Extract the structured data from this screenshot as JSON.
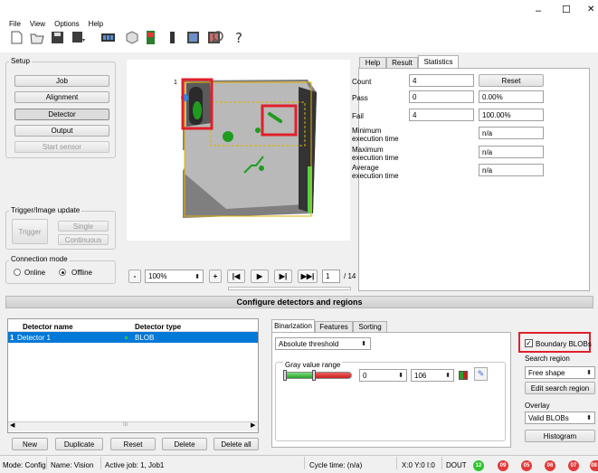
{
  "menu": [
    "File",
    "View",
    "Options",
    "Help"
  ],
  "window": {
    "minimize": "–",
    "maximize": "☐",
    "close": "✕"
  },
  "setup": {
    "title": "Setup",
    "buttons": [
      "Job",
      "Alignment",
      "Detector",
      "Output",
      "Start sensor"
    ]
  },
  "trigger": {
    "title": "Trigger/Image update",
    "trigger": "Trigger",
    "single": "Single",
    "continuous": "Continuous"
  },
  "connection": {
    "title": "Connection mode",
    "online": "Online",
    "offline": "Offline"
  },
  "imagectrl": {
    "minus": "-",
    "zoom": "100%",
    "plus": "+",
    "page": "1",
    "total": "/ 14"
  },
  "image": {
    "marker_label": "1"
  },
  "tabs": {
    "help": "Help",
    "result": "Result",
    "statistics": "Statistics"
  },
  "stats": {
    "count_label": "Count",
    "count_value": "4",
    "reset": "Reset",
    "pass_label": "Pass",
    "pass_value": "0",
    "pass_pct": "0.00%",
    "fail_label": "Fail",
    "fail_value": "4",
    "fail_pct": "100.00%",
    "min_label_1": "Minimum",
    "min_label_2": "execution time",
    "min_value": "n/a",
    "max_label_1": "Maximum",
    "max_label_2": "execution time",
    "max_value": "n/a",
    "avg_label_1": "Average",
    "avg_label_2": "execution time",
    "avg_value": "n/a"
  },
  "section_title": "Configure detectors and regions",
  "detectors": {
    "col_name": "Detector name",
    "col_type": "Detector type",
    "rows": [
      {
        "index": "1",
        "name": "Detector 1",
        "type": "BLOB"
      }
    ],
    "scroll_mark": "III",
    "buttons": {
      "new": "New",
      "duplicate": "Duplicate",
      "reset": "Reset",
      "delete": "Delete",
      "delete_all": "Delete all"
    }
  },
  "subtabs": {
    "binarization": "Binarization",
    "features": "Features",
    "sorting": "Sorting"
  },
  "binarization": {
    "threshold_mode": "Absolute threshold",
    "gray_title": "Gray value range",
    "low": "0",
    "high": "106"
  },
  "right": {
    "boundary": "Boundary BLOBs",
    "search_title": "Search region",
    "search_value": "Free shape",
    "edit": "Edit search region",
    "overlay_title": "Overlay",
    "overlay_value": "Valid BLOBs",
    "histogram": "Histogram"
  },
  "status": {
    "mode": "Mode:  Config",
    "name": "Name:  Vision",
    "job": "Active job:  1, Job1",
    "cycle": "Cycle time:  (n/a)",
    "xyi": "X:0 Y:0 I:0",
    "dout": "DOUT",
    "leds": [
      {
        "label": "12",
        "color": "#2fc42f"
      },
      {
        "label": "09",
        "color": "#e23b3b"
      },
      {
        "label": "05",
        "color": "#e23b3b"
      },
      {
        "label": "06",
        "color": "#e23b3b"
      },
      {
        "label": "07",
        "color": "#e23b3b"
      },
      {
        "label": "08",
        "color": "#e23b3b"
      }
    ]
  },
  "colors": {
    "accent_red": "#e0202a",
    "selection": "#0078d7",
    "blob_green": "#1fa81f"
  }
}
